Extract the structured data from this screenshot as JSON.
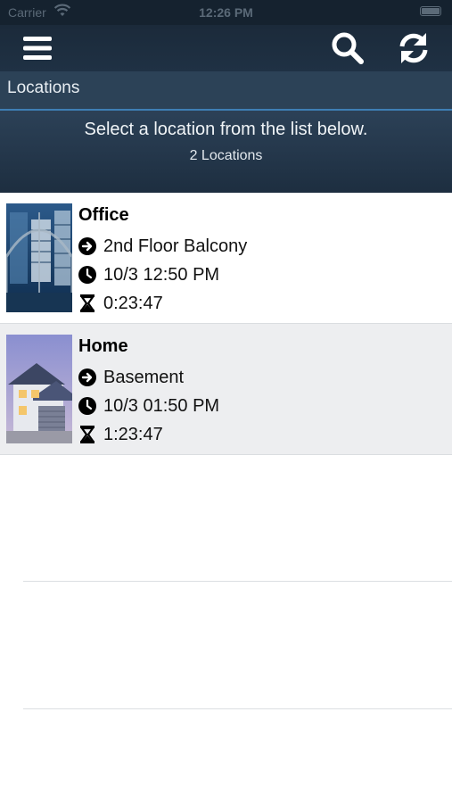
{
  "status_bar": {
    "carrier": "Carrier",
    "time": "12:26 PM"
  },
  "nav": {
    "menu_icon": "hamburger-menu-icon",
    "search_icon": "search-icon",
    "refresh_icon": "refresh-icon"
  },
  "section": {
    "title": "Locations"
  },
  "info": {
    "prompt": "Select a location from the list below.",
    "count": "2 Locations"
  },
  "locations": [
    {
      "name": "Office",
      "area": "2nd Floor Balcony",
      "time": "10/3 12:50 PM",
      "duration": "0:23:47",
      "thumbnail": "office-building-image"
    },
    {
      "name": "Home",
      "area": "Basement",
      "time": "10/3 01:50 PM",
      "duration": "1:23:47",
      "thumbnail": "house-image"
    }
  ],
  "colors": {
    "nav_bg": "#1b2a3a",
    "section_bg": "#2c4257",
    "accent_line": "#3e7fb5",
    "alt_row_bg": "#edeef0"
  }
}
